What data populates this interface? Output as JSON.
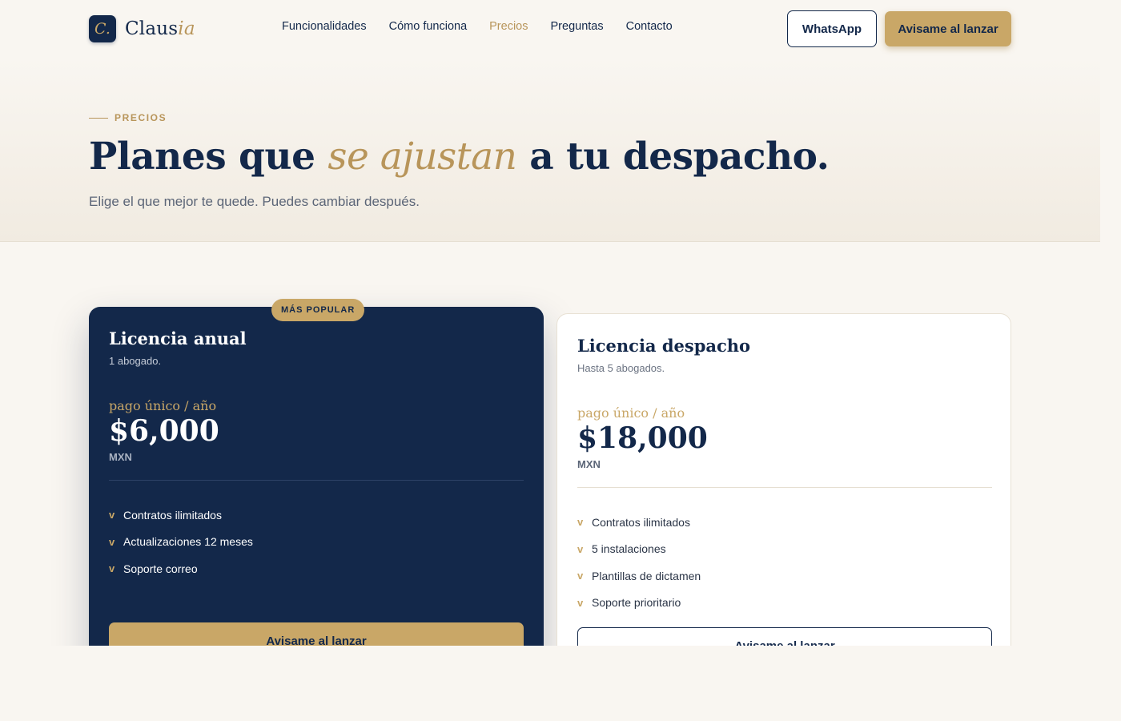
{
  "brand": {
    "mark": "C.",
    "name_main": "Claus",
    "name_accent": "ia"
  },
  "nav": {
    "items": [
      {
        "label": "Funcionalidades",
        "active": false
      },
      {
        "label": "Cómo funciona",
        "active": false
      },
      {
        "label": "Precios",
        "active": true
      },
      {
        "label": "Preguntas",
        "active": false
      },
      {
        "label": "Contacto",
        "active": false
      }
    ]
  },
  "header": {
    "whatsapp_label": "WhatsApp",
    "launch_label": "Avisame al lanzar"
  },
  "hero": {
    "eyebrow": "PRECIOS",
    "title_before": "Planes que ",
    "title_accent": "se ajustan",
    "title_after": " a tu despacho.",
    "subtitle": "Elige el que mejor te quede. Puedes cambiar después."
  },
  "plans": [
    {
      "badge": "MÁS POPULAR",
      "name": "Licencia anual",
      "seats": "1 abogado.",
      "period": "pago único / año",
      "price": "$6,000",
      "currency": "MXN",
      "features": [
        "Contratos ilimitados",
        "Actualizaciones 12 meses",
        "Soporte correo"
      ],
      "cta": "Avisame al lanzar"
    },
    {
      "name": "Licencia despacho",
      "seats": "Hasta 5 abogados.",
      "period": "pago único / año",
      "price": "$18,000",
      "currency": "MXN",
      "features": [
        "Contratos ilimitados",
        "5 instalaciones",
        "Plantillas de dictamen",
        "Soporte prioritario"
      ],
      "cta": "Avisame al lanzar"
    }
  ],
  "check_glyph": "v",
  "colors": {
    "navy": "#13284a",
    "gold": "#c9a767",
    "gold_text": "#b8955a",
    "background": "#f9f6f1"
  }
}
